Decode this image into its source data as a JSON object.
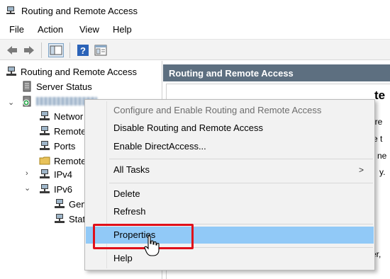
{
  "window": {
    "title": "Routing and Remote Access"
  },
  "menubar": {
    "items": [
      "File",
      "Action",
      "View",
      "Help"
    ]
  },
  "toolbar": {
    "buttons": [
      "back-icon",
      "forward-icon",
      "show-hide-console-tree-icon",
      "help-icon",
      "properties-icon"
    ]
  },
  "tree": {
    "root": "Routing and Remote Access",
    "server_status": "Server Status",
    "server_name": "[hidden server name]",
    "items": {
      "network": "Networ",
      "remote_clients": "Remote",
      "ports": "Ports",
      "remote_folder": "Remote",
      "ipv4": "IPv4",
      "ipv6": "IPv6",
      "general": "Gen",
      "static": "Stat"
    }
  },
  "right_pane": {
    "header": "Routing and Remote Access",
    "fragments": [
      "te",
      "ure",
      "re t",
      "e ne",
      "y.",
      "ver,"
    ]
  },
  "context_menu": {
    "configure": "Configure and Enable Routing and Remote Access",
    "disable": "Disable Routing and Remote Access",
    "directaccess": "Enable DirectAccess...",
    "all_tasks": "All Tasks",
    "all_tasks_arrow": ">",
    "delete": "Delete",
    "refresh": "Refresh",
    "properties": "Properties",
    "help": "Help"
  },
  "colors": {
    "highlight": "#91c9f7",
    "annotation": "#e0101a",
    "pane_header": "#5d6f80"
  }
}
